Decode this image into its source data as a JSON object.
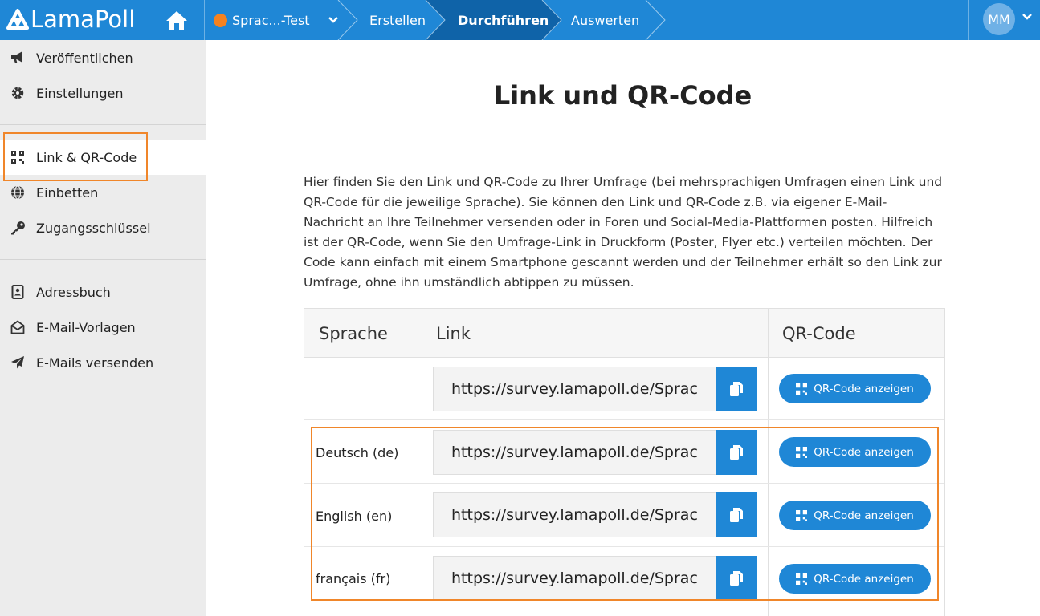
{
  "app": {
    "logo_text": "LamaPoll"
  },
  "nav": {
    "survey_name": "Sprac...-Test",
    "steps": [
      "Erstellen",
      "Durchführen",
      "Auswerten"
    ],
    "active_step": "Durchführen",
    "user_initials": "MM"
  },
  "sidebar": {
    "items": [
      {
        "label": "Veröffentlichen",
        "icon": "megaphone-icon"
      },
      {
        "label": "Einstellungen",
        "icon": "gear-icon"
      },
      {
        "label": "Link & QR-Code",
        "icon": "qr-code-icon",
        "active": true
      },
      {
        "label": "Einbetten",
        "icon": "globe-icon"
      },
      {
        "label": "Zugangsschlüssel",
        "icon": "key-icon"
      },
      {
        "label": "Adressbuch",
        "icon": "address-book-icon"
      },
      {
        "label": "E-Mail-Vorlagen",
        "icon": "envelope-open-icon"
      },
      {
        "label": "E-Mails versenden",
        "icon": "paper-plane-icon"
      }
    ]
  },
  "main": {
    "title": "Link und QR-Code",
    "intro": "Hier finden Sie den Link und QR-Code zu Ihrer Umfrage (bei mehrsprachigen Umfragen einen Link und QR-Code für die jeweilige Sprache). Sie können den Link und QR-Code z.B. via eigener E-Mail-Nachricht an Ihre Teilnehmer versenden oder in Foren und Social-Media-Plattformen posten. Hilfreich ist der QR-Code, wenn Sie den Umfrage-Link in Druckform (Poster, Flyer etc.) verteilen möchten. Der Code kann einfach mit einem Smartphone gescannt werden und der Teilnehmer erhält so den Link zur Umfrage, ohne ihn umständlich abtippen zu müssen.",
    "table": {
      "headers": [
        "Sprache",
        "Link",
        "QR-Code"
      ],
      "qr_button_label": "QR-Code anzeigen",
      "rows": [
        {
          "language": "",
          "link": "https://survey.lamapoll.de/Sprac"
        },
        {
          "language": "Deutsch (de)",
          "link": "https://survey.lamapoll.de/Sprac"
        },
        {
          "language": "English (en)",
          "link": "https://survey.lamapoll.de/Sprac"
        },
        {
          "language": "français (fr)",
          "link": "https://survey.lamapoll.de/Sprac"
        }
      ]
    }
  },
  "colors": {
    "brand_blue": "#1f87d6",
    "active_step_blue": "#0f63a8",
    "highlight_orange": "#f0862a",
    "survey_dot": "#f58220",
    "sidebar_bg": "#ececec"
  }
}
